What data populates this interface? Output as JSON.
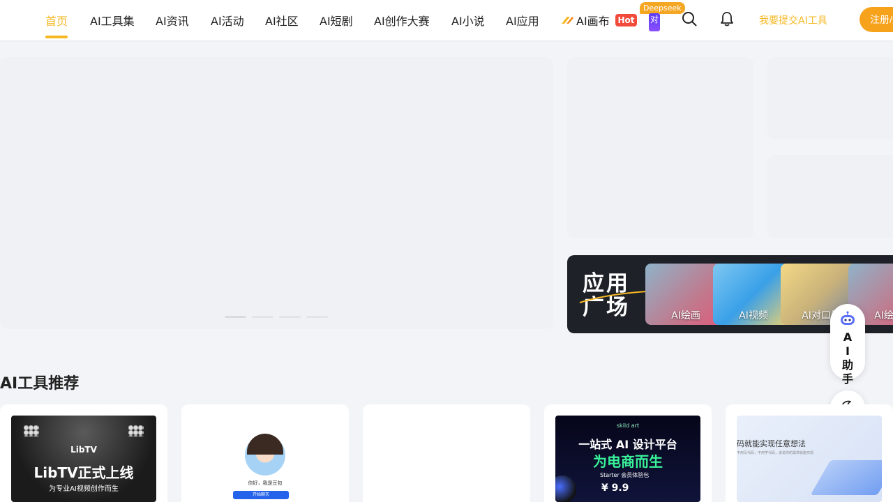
{
  "nav": {
    "items": [
      {
        "label": "首页",
        "active": true
      },
      {
        "label": "AI工具集"
      },
      {
        "label": "AI资讯"
      },
      {
        "label": "AI活动"
      },
      {
        "label": "AI社区"
      },
      {
        "label": "AI短剧"
      },
      {
        "label": "AI创作大赛"
      },
      {
        "label": "AI小说"
      },
      {
        "label": "AI应用"
      },
      {
        "label": "AI画布"
      }
    ],
    "hot_badge": "Hot",
    "deepseek_badge": "Deepseek",
    "deepseek_tile": "对",
    "submit_link": "我要提交AI工具",
    "register_button": "注册/登录",
    "accent_color": "#f5b823"
  },
  "app_plaza": {
    "title": "应用广场",
    "cards": [
      {
        "label": "AI绘画"
      },
      {
        "label": "AI视频"
      },
      {
        "label": "AI对口型"
      },
      {
        "label": "AI绘画"
      }
    ]
  },
  "float": {
    "assistant_label": "AI助手",
    "icons": [
      "robot-icon",
      "moon-icon",
      "chevron-up-icon"
    ]
  },
  "section": {
    "title": "AI工具推荐"
  },
  "tool_cards": {
    "libtv": {
      "logo": "LibTV",
      "headline": "LibTV正式上线",
      "sub": "为专业AI视频创作而生"
    },
    "avatar": {
      "greeting": "你好，我是豆包",
      "button": "开始聊天"
    },
    "skild": {
      "brand": "skild art",
      "line1": "一站式 AI 设计平台",
      "line2": "为电商而生",
      "pill": "Starter 会员体验包",
      "price": "¥ 9.9"
    },
    "ideas": {
      "title": "码就能实现任意想法",
      "sub": "不用写代码，不用学代码，说说你的需求就能实现"
    }
  }
}
